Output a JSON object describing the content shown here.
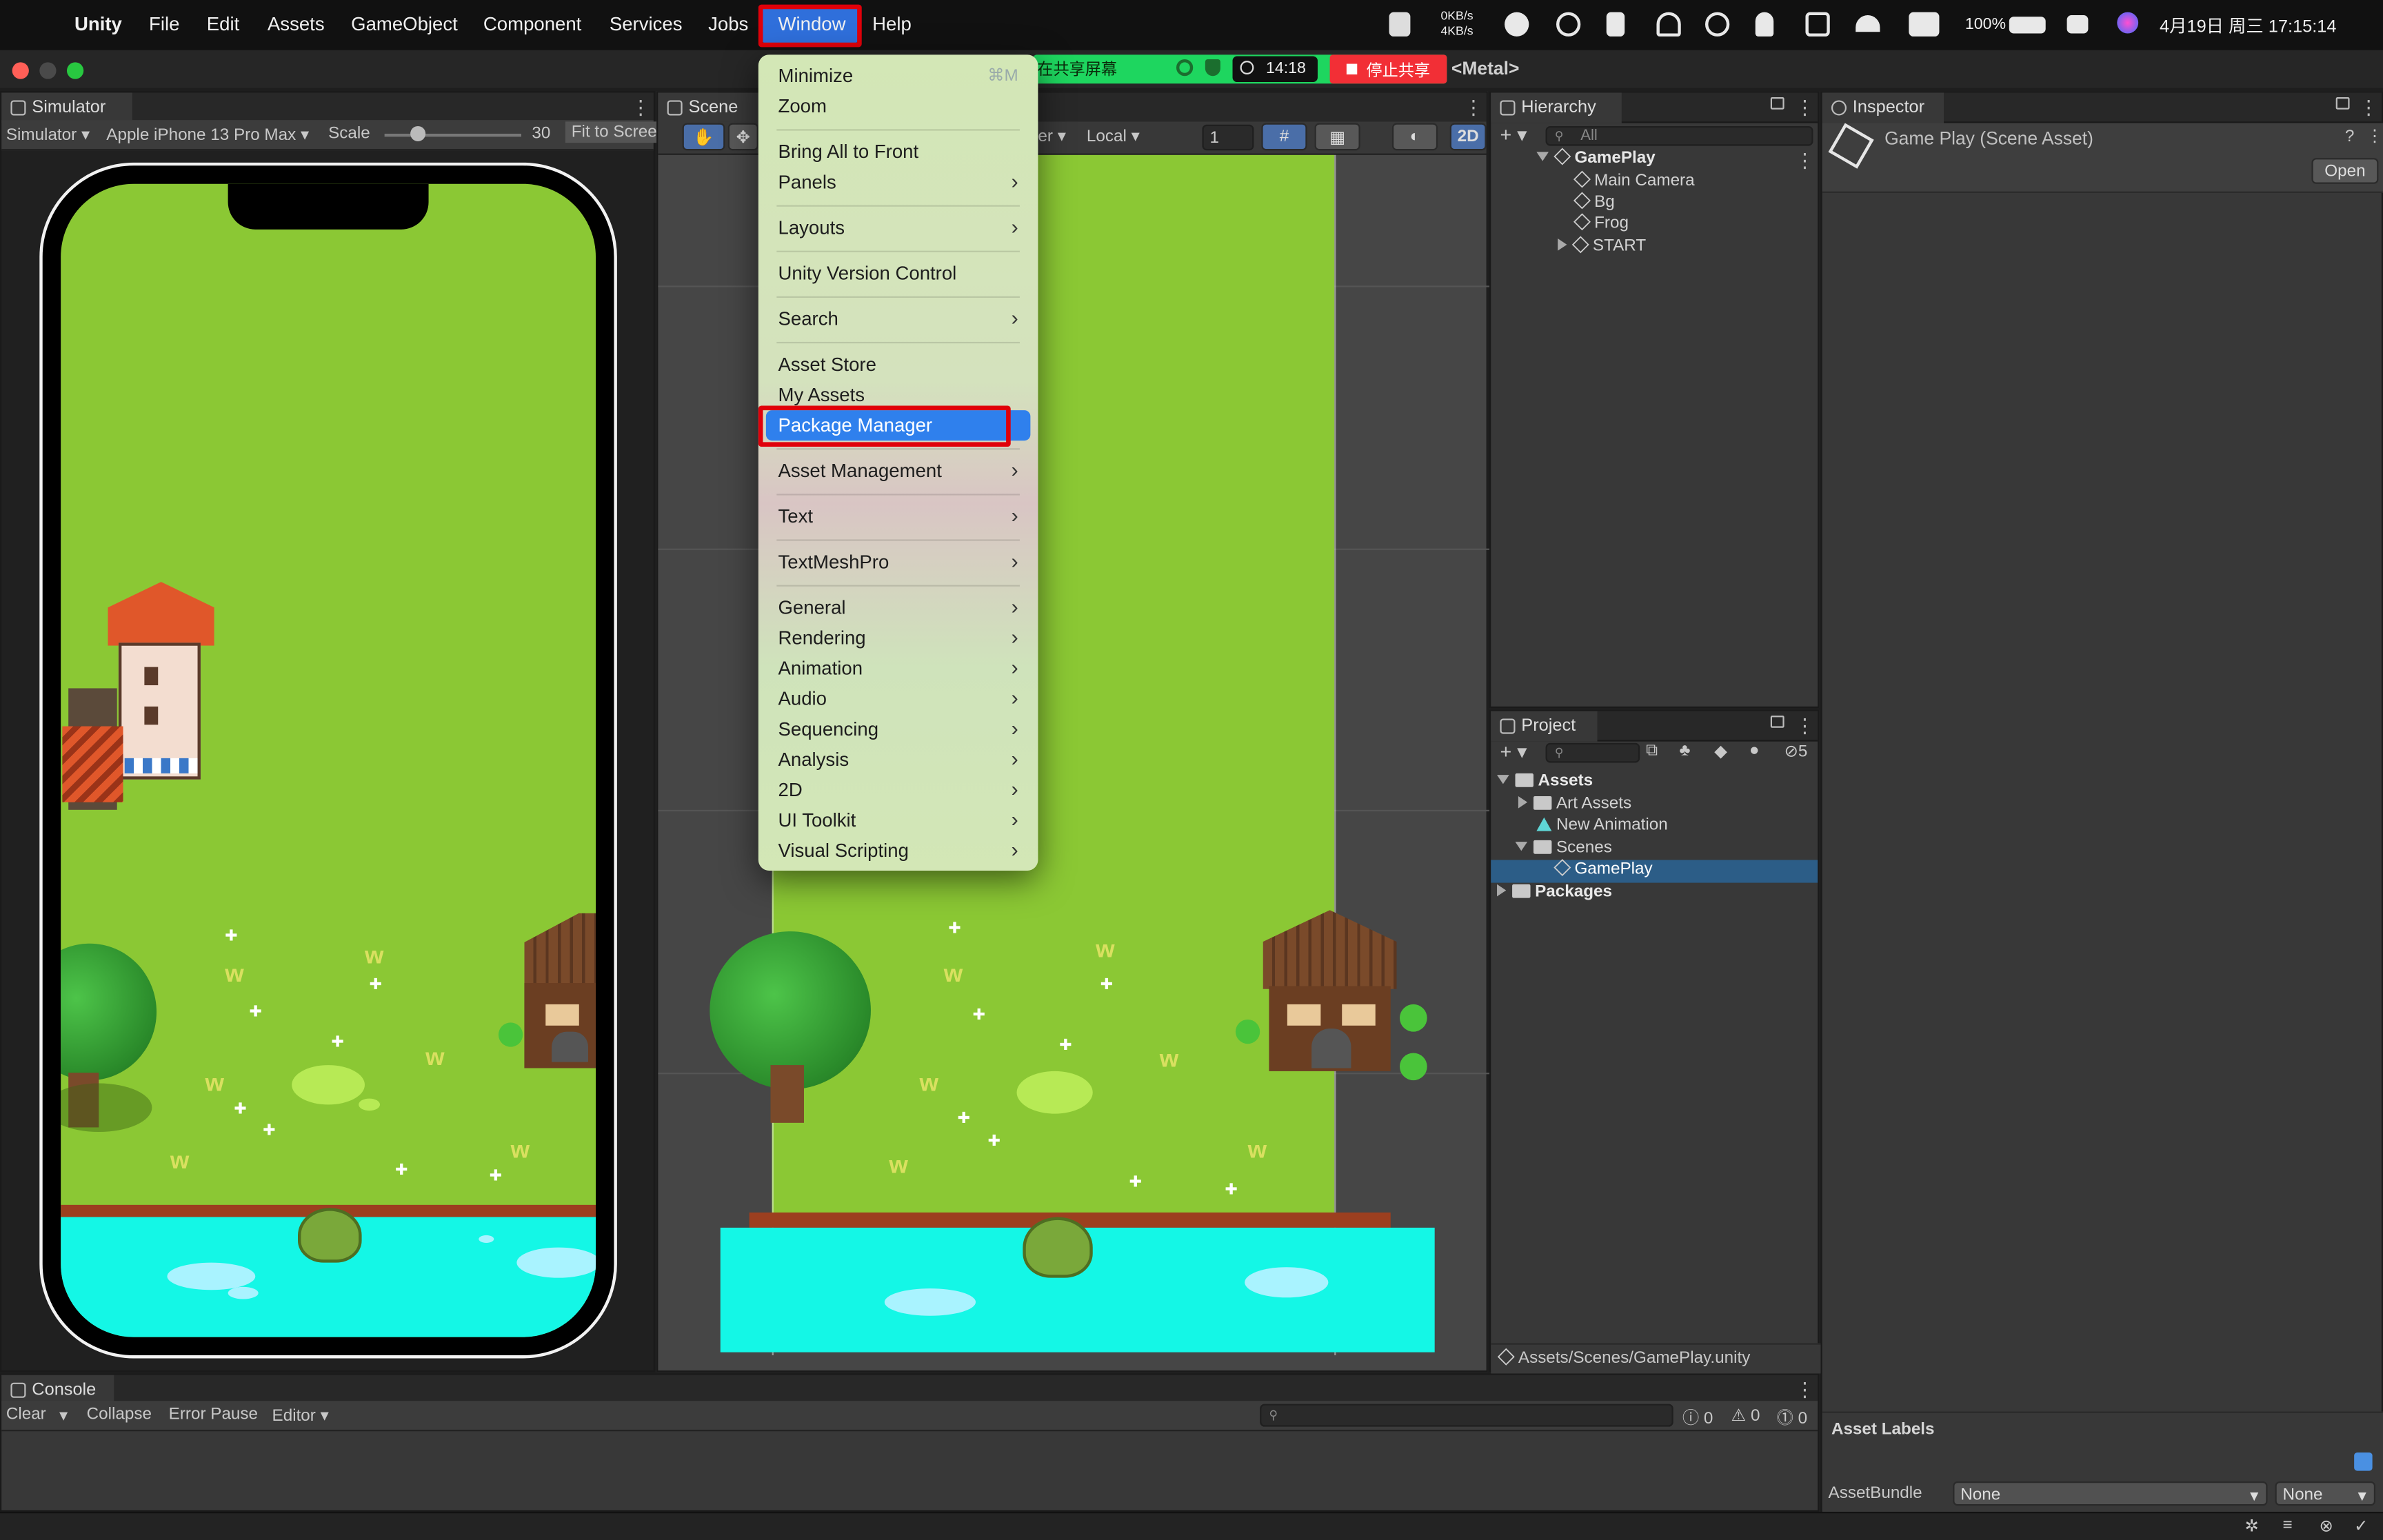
{
  "menubar": {
    "app_name": "Unity",
    "items": [
      "File",
      "Edit",
      "Assets",
      "GameObject",
      "Component",
      "Services",
      "Jobs",
      "Window",
      "Help"
    ],
    "net_up": "0KB/s",
    "net_down": "4KB/s",
    "battery": "100%",
    "datetime": "4月19日 周三  17:15:14"
  },
  "sharing": {
    "label": "正在共享屏幕",
    "timer": "14:18",
    "stop_label": "停止共享"
  },
  "title": {
    "suffix": "<Metal>"
  },
  "simulator": {
    "tab": "Simulator",
    "mode": "Simulator",
    "device": "Apple iPhone 13 Pro Max",
    "scale_label": "Scale",
    "scale_value": "30",
    "fit_label": "Fit to Screen"
  },
  "scene": {
    "tab": "Scene",
    "pivot_partial": "er",
    "space": "Local",
    "grid_value": "1",
    "mode_2d": "2D"
  },
  "window_menu": {
    "items": [
      {
        "label": "Minimize",
        "shortcut": "⌘M"
      },
      {
        "label": "Zoom"
      },
      {
        "label": "Bring All to Front"
      },
      {
        "label": "Panels",
        "submenu": true
      },
      {
        "label": "Layouts",
        "submenu": true
      },
      {
        "label": "Unity Version Control"
      },
      {
        "label": "Search",
        "submenu": true
      },
      {
        "label": "Asset Store"
      },
      {
        "label": "My Assets"
      },
      {
        "label": "Package Manager",
        "highlighted": true
      },
      {
        "label": "Asset Management",
        "submenu": true
      },
      {
        "label": "Text",
        "submenu": true
      },
      {
        "label": "TextMeshPro",
        "submenu": true
      },
      {
        "label": "General",
        "submenu": true
      },
      {
        "label": "Rendering",
        "submenu": true
      },
      {
        "label": "Animation",
        "submenu": true
      },
      {
        "label": "Audio",
        "submenu": true
      },
      {
        "label": "Sequencing",
        "submenu": true
      },
      {
        "label": "Analysis",
        "submenu": true
      },
      {
        "label": "2D",
        "submenu": true
      },
      {
        "label": "UI Toolkit",
        "submenu": true
      },
      {
        "label": "Visual Scripting",
        "submenu": true
      }
    ]
  },
  "hierarchy": {
    "tab": "Hierarchy",
    "search_placeholder": "All",
    "root": "GamePlay",
    "children": [
      "Main Camera",
      "Bg",
      "Frog",
      "START"
    ]
  },
  "inspector": {
    "tab": "Inspector",
    "title": "Game Play (Scene Asset)",
    "open_button": "Open",
    "asset_labels": "Asset Labels",
    "assetbundle_label": "AssetBundle",
    "assetbundle_value": "None",
    "variant_value": "None"
  },
  "project": {
    "tab": "Project",
    "hidden_count": "5",
    "tree": {
      "assets": "Assets",
      "art_assets": "Art Assets",
      "new_animation": "New Animation",
      "scenes": "Scenes",
      "gameplay": "GamePlay",
      "packages": "Packages"
    },
    "path": "Assets/Scenes/GamePlay.unity"
  },
  "console": {
    "tab": "Console",
    "clear": "Clear",
    "collapse": "Collapse",
    "error_pause": "Error Pause",
    "editor": "Editor",
    "log_count": "0",
    "warn_count": "0",
    "error_count": "0"
  },
  "colors": {
    "grass": "#8bc834",
    "water": "#14f7e6",
    "highlight": "#2f80ed",
    "annotation": "#e0000a",
    "selection": "#2c5d87"
  }
}
